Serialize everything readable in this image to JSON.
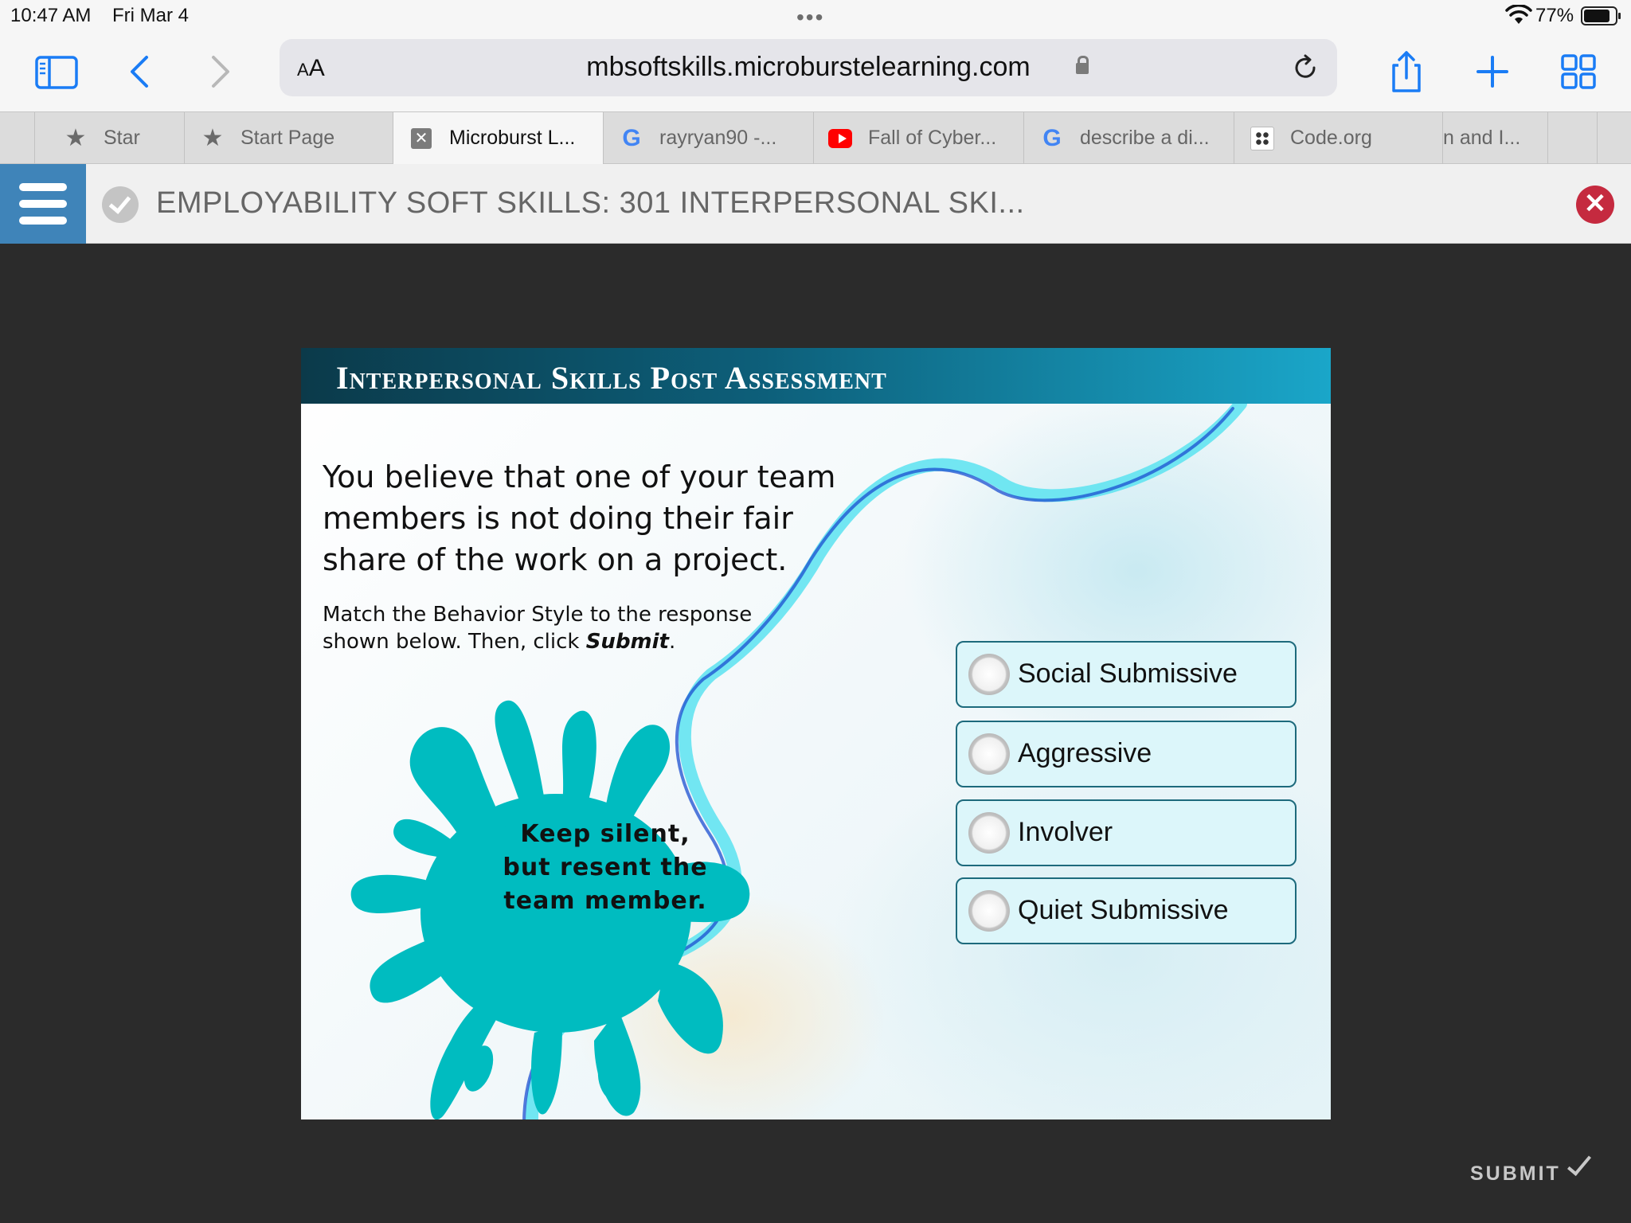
{
  "status_bar": {
    "time": "10:47 AM",
    "date": "Fri Mar 4",
    "battery": "77%"
  },
  "browser": {
    "address_prefix_small": "A",
    "address_prefix": "A",
    "url": "mbsoftskills.microburstelearning.com",
    "tabs": [
      {
        "label": "Star",
        "icon": "star-icon"
      },
      {
        "label": "Start Page",
        "icon": "star-icon"
      },
      {
        "label": "Microburst L...",
        "icon": "close-favicon",
        "active": true
      },
      {
        "label": "rayryan90 -...",
        "icon": "google-icon"
      },
      {
        "label": "Fall of Cyber...",
        "icon": "youtube-icon"
      },
      {
        "label": "describe a di...",
        "icon": "google-icon"
      },
      {
        "label": "Code.org",
        "icon": "code-org-icon"
      },
      {
        "label": "n and I...",
        "icon": ""
      }
    ]
  },
  "course": {
    "title": "EMPLOYABILITY SOFT SKILLS: 301 INTERPERSONAL SKI...",
    "close_symbol": "✕"
  },
  "slide": {
    "header": "Interpersonal Skills Post Assessment",
    "question": "You believe that one of your team members is not doing their fair share of the work on a project.",
    "instruction_prefix": "Match the Behavior Style to the response shown below. Then, click ",
    "instruction_emphasis": "Submit",
    "instruction_suffix": ".",
    "response_lines": [
      "Keep silent,",
      "but resent the",
      "team member."
    ],
    "options": [
      "Social Submissive",
      "Aggressive",
      "Involver",
      "Quiet Submissive"
    ],
    "colors": {
      "splat": "#00bcc0",
      "header_dark": "#0b3a4a",
      "header_light": "#1aa6c9",
      "option_bg": "#dcf6fa",
      "option_border": "#1d6a7c"
    }
  },
  "footer": {
    "submit_label": "SUBMIT"
  },
  "colors": {
    "menu_button": "#3f84b9",
    "close_button": "#c52a3f",
    "ios_blue": "#1a7cf5",
    "page_bg": "#2b2b2b"
  }
}
